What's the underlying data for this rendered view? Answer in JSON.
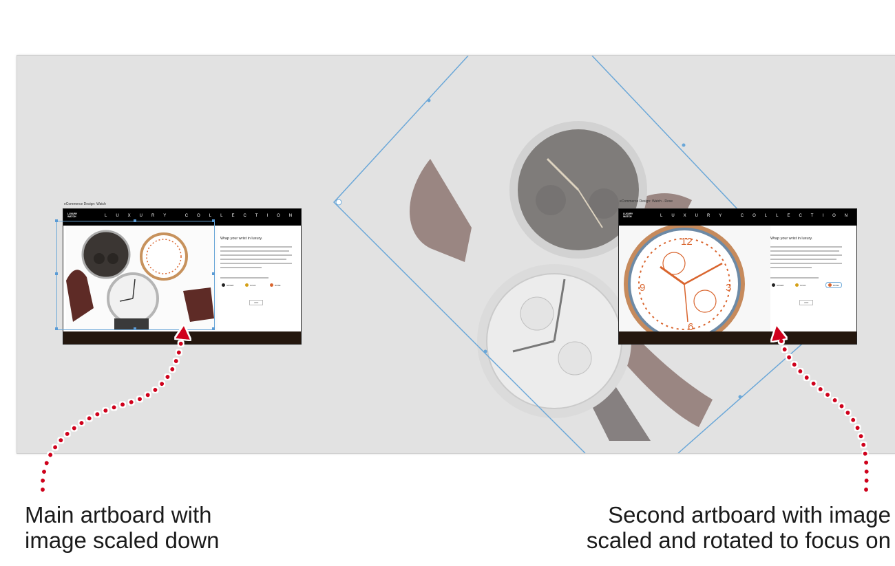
{
  "artboards": {
    "main": {
      "label": "eCommerce Design: Watch",
      "header_text": "LUXURY COLLECTION",
      "logo_text": "LUXURY WATCH",
      "title": "Wrap your wrist in luxury.",
      "option_1": "SILVER",
      "option_2": "GOLD",
      "option_3": "ROSE",
      "button_label": "ADD"
    },
    "second": {
      "label": "eCommerce Design: Watch - Rose",
      "header_text": "LUXURY COLLECTION",
      "logo_text": "LUXURY WATCH",
      "title": "Wrap your wrist in luxury.",
      "option_1": "SILVER",
      "option_2": "GOLD",
      "option_3": "ROSE",
      "button_label": "ADD"
    }
  },
  "captions": {
    "left_line1": "Main artboard with",
    "left_line2": "image scaled down",
    "right_line1": "Second artboard with image",
    "right_line2": "scaled and rotated to focus on"
  },
  "colors": {
    "canvas": "#e2e2e2",
    "selection": "#6aa7d8",
    "callout_dots": "#d0021b",
    "header": "#000000",
    "footer": "#24170e",
    "rose_accent": "#d9652e"
  }
}
